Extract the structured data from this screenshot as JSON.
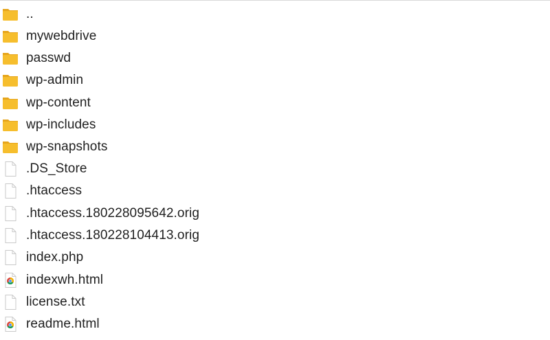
{
  "files": [
    {
      "name": "..",
      "kind": "folder",
      "icon": "folder-icon"
    },
    {
      "name": "mywebdrive",
      "kind": "folder",
      "icon": "folder-icon"
    },
    {
      "name": "passwd",
      "kind": "folder",
      "icon": "folder-icon"
    },
    {
      "name": "wp-admin",
      "kind": "folder",
      "icon": "folder-icon"
    },
    {
      "name": "wp-content",
      "kind": "folder",
      "icon": "folder-icon"
    },
    {
      "name": "wp-includes",
      "kind": "folder",
      "icon": "folder-icon"
    },
    {
      "name": "wp-snapshots",
      "kind": "folder",
      "icon": "folder-icon"
    },
    {
      "name": ".DS_Store",
      "kind": "file",
      "icon": "document-icon"
    },
    {
      "name": ".htaccess",
      "kind": "file",
      "icon": "document-icon"
    },
    {
      "name": ".htaccess.180228095642.orig",
      "kind": "file",
      "icon": "document-icon"
    },
    {
      "name": ".htaccess.180228104413.orig",
      "kind": "file",
      "icon": "document-icon"
    },
    {
      "name": "index.php",
      "kind": "file",
      "icon": "document-icon"
    },
    {
      "name": "indexwh.html",
      "kind": "html",
      "icon": "chrome-document-icon"
    },
    {
      "name": "license.txt",
      "kind": "file",
      "icon": "document-icon"
    },
    {
      "name": "readme.html",
      "kind": "html",
      "icon": "chrome-document-icon"
    }
  ],
  "colors": {
    "folder_body": "#f6be2d",
    "folder_tab": "#e6a51c",
    "doc_border": "#c9c9c9",
    "text": "#1f1f1f"
  }
}
